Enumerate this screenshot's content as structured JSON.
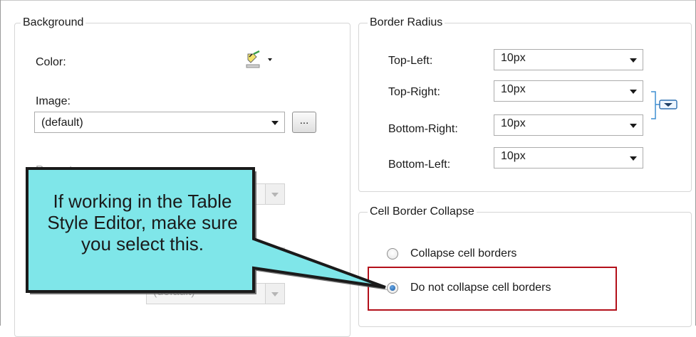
{
  "background": {
    "legend": "Background",
    "color_label": "Color:",
    "image_label": "Image:",
    "image_value": "(default)",
    "browse_label": "...",
    "repeat_label": "Repeat:",
    "hidden_combo_value": "(default)"
  },
  "border_radius": {
    "legend": "Border Radius",
    "rows": [
      {
        "label": "Top-Left:",
        "value": "10px"
      },
      {
        "label": "Top-Right:",
        "value": "10px"
      },
      {
        "label": "Bottom-Right:",
        "value": "10px"
      },
      {
        "label": "Bottom-Left:",
        "value": "10px"
      }
    ]
  },
  "cell_border_collapse": {
    "legend": "Cell Border Collapse",
    "options": [
      {
        "label": "Collapse cell borders",
        "checked": false
      },
      {
        "label": "Do not collapse cell borders",
        "checked": true
      }
    ]
  },
  "callout": {
    "text": "If working in the Table Style Editor, make sure you select this."
  },
  "colors": {
    "callout_fill": "#7fe6e9",
    "highlight_border": "#b3101a"
  },
  "icons": {
    "color_picker": "paint-bucket-icon",
    "link": "link-values-icon"
  }
}
